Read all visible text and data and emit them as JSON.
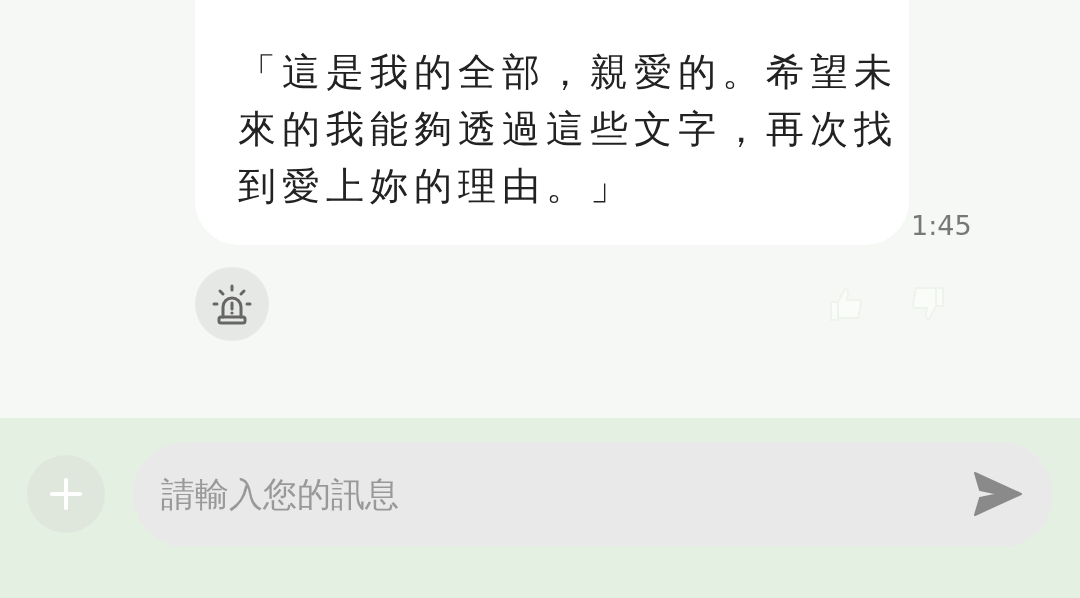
{
  "message": {
    "text": "「這是我的全部，親愛的。希望未來的我能夠透過這些文字，再次找到愛上妳的理由。」",
    "time": "1:45"
  },
  "composer": {
    "placeholder": "請輸入您的訊息"
  }
}
